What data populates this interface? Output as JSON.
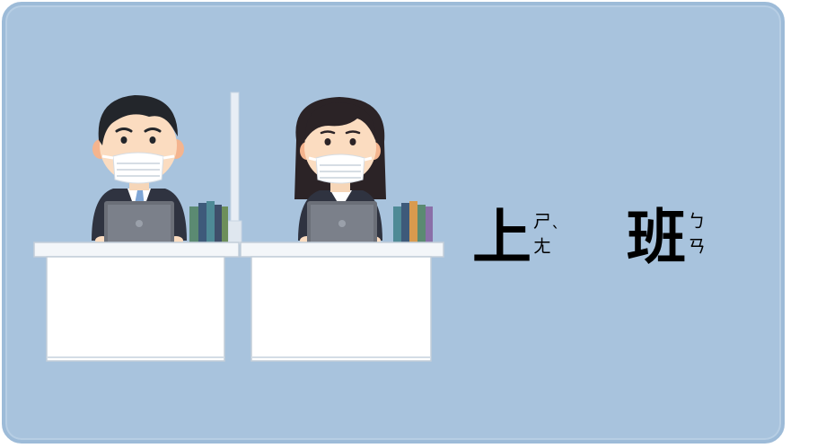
{
  "words": [
    {
      "character": "上",
      "zhuyin": [
        "ㄕ",
        "ㄤ"
      ],
      "tone": "ˋ"
    },
    {
      "character": "班",
      "zhuyin": [
        "ㄅ",
        "ㄢ"
      ],
      "tone": ""
    }
  ],
  "colors": {
    "card_background": "#a8c3dd",
    "card_border": "#9dbbd8",
    "text": "#000000"
  },
  "illustration": {
    "figures": [
      "man-with-mask",
      "woman-with-mask"
    ],
    "objects": [
      "laptop",
      "laptop",
      "desk",
      "desk",
      "partition",
      "books",
      "books"
    ]
  }
}
